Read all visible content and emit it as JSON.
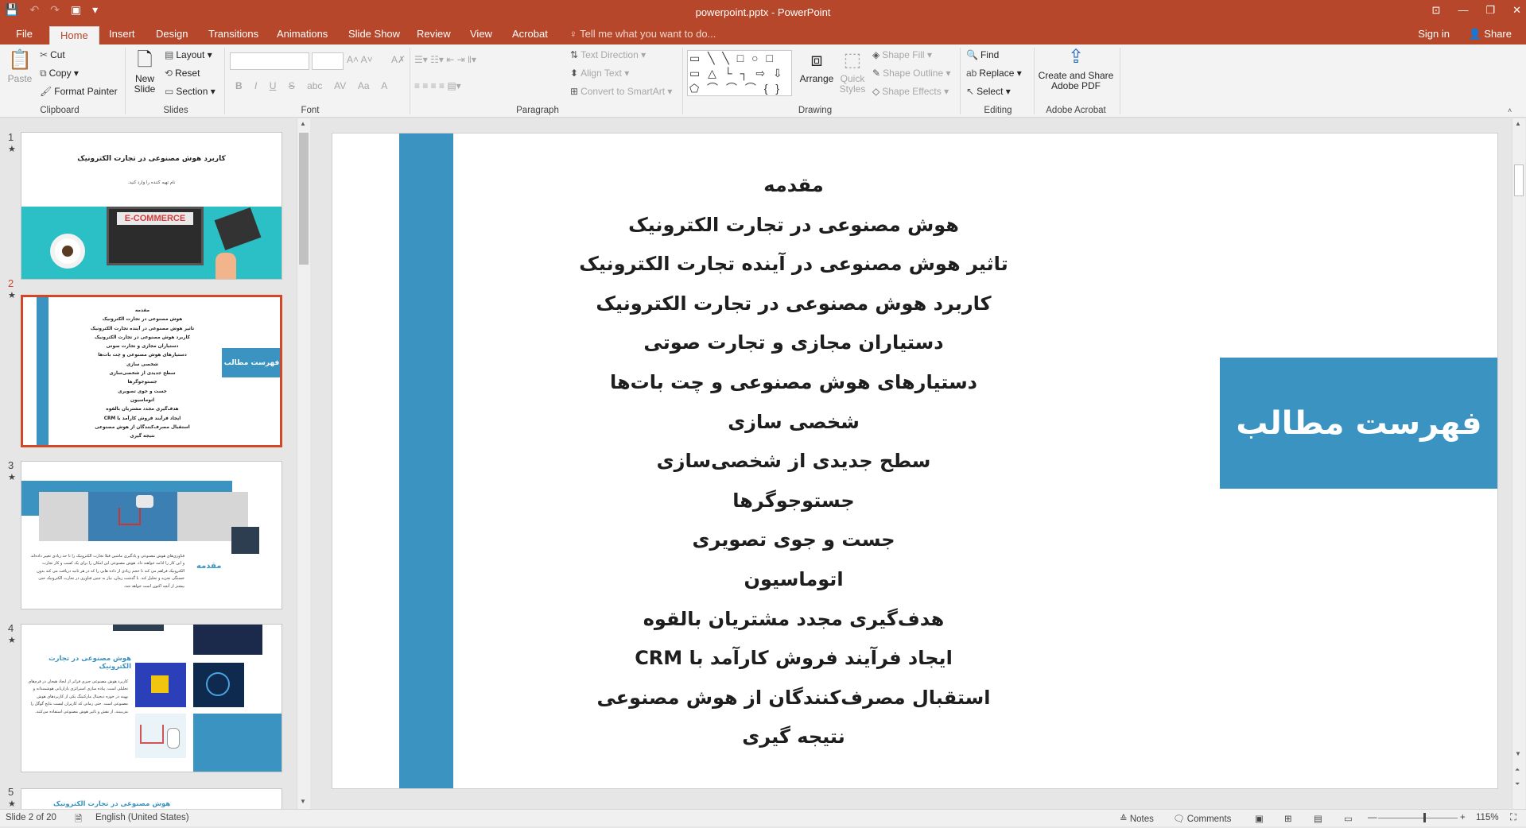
{
  "window": {
    "title": "powerpoint.pptx - PowerPoint",
    "controls": [
      "⊡",
      "—",
      "❐",
      "✕"
    ]
  },
  "qat": {
    "save": "💾",
    "undo": "↶",
    "redo": "↷",
    "present": "▣",
    "more": "▾"
  },
  "tabs": [
    "File",
    "Home",
    "Insert",
    "Design",
    "Transitions",
    "Animations",
    "Slide Show",
    "Review",
    "View",
    "Acrobat"
  ],
  "tell_me": "Tell me what you want to do...",
  "sign_in": "Sign in",
  "share": "Share",
  "ribbon": {
    "clipboard": {
      "paste": "Paste",
      "cut": "Cut",
      "copy": "Copy",
      "format_painter": "Format Painter",
      "label": "Clipboard"
    },
    "slides": {
      "new_slide": "New Slide",
      "layout": "Layout",
      "reset": "Reset",
      "section": "Section",
      "label": "Slides"
    },
    "font": {
      "bold": "B",
      "italic": "I",
      "underline": "U",
      "strike": "S",
      "shadow": "abc",
      "spacing": "AV",
      "case": "Aa",
      "color": "A",
      "label": "Font"
    },
    "paragraph": {
      "text_direction": "Text Direction",
      "align_text": "Align Text",
      "convert_smartart": "Convert to SmartArt",
      "label": "Paragraph"
    },
    "drawing": {
      "shapes": "▭ ╲ ╲ □ ○ □ ▭ △ └ ┐ ⇨ ⇩ ⬠ ⌒ ⌒ ⌒ { } ☆",
      "arrange": "Arrange",
      "quick_styles": "Quick Styles",
      "shape_fill": "Shape Fill",
      "shape_outline": "Shape Outline",
      "shape_effects": "Shape Effects",
      "label": "Drawing"
    },
    "editing": {
      "find": "Find",
      "replace": "Replace",
      "select": "Select",
      "label": "Editing"
    },
    "acrobat": {
      "create_share": "Create and Share Adobe PDF",
      "label": "Adobe Acrobat"
    }
  },
  "thumbnails": [
    {
      "num": "1",
      "title": "کاربرد هوش مصنوعی در تجارت الکترونیک",
      "subtitle": "نام تهیه کننده را وارد کنید.",
      "banner": "E-COMMERCE"
    },
    {
      "num": "2",
      "box": "فهرست مطالب"
    },
    {
      "num": "3",
      "heading": "مقدمه",
      "text": "فناوری‌های هوش مصنوعی و یادگیری ماشین قبلا تجارت الکترونیک را تا حد زیادی تغییر داده‌اند و این کار را ادامه خواهند داد. هوش مصنوعی این امکان را برای یک کسب و کار تجارت الکترونیک فراهم می کند تا حجم زیادی از داده هایی را که در هر ثانیه دریافت می کند بدون خستگی تجزیه و تحلیل کند. با گذشت زمان، نیاز به چنین فناوری در تجارت الکترونیک حتی بیشتر از آنچه اکنون است خواهد شد."
    },
    {
      "num": "4",
      "heading": "هوش مصنوعی در تجارت الکترونیک",
      "text": "کاربرد هوش مصنوعی چیزی فراتر از ایجاد هیجان در فرم‌های تحلیلی است. پیاده سازی استراتژی بازاریابی هوشمندانه و بهینه در حوزه دیجیتال مارکتینگ یکی از کاربردهای هوش مصنوعی است. حتی زمانی که کاربران لیست نتایج گوگل را می‌بینند، از نقش و تاثیر هوش مصنوعی استفاده می‌کنند."
    },
    {
      "num": "5",
      "heading": "هوش مصنوعی در تجارت الکترونیک"
    }
  ],
  "slide": {
    "toc_items": [
      "مقدمه",
      "هوش مصنوعی در تجارت الکترونیک",
      "تاثیر هوش مصنوعی در آینده تجارت الکترونیک",
      "کاربرد هوش مصنوعی در تجارت الکترونیک",
      "دستیاران مجازی و تجارت صوتی",
      "دستیارهای هوش مصنوعی و چت بات‌ها",
      "شخصی سازی",
      "سطح جدیدی از شخصی‌سازی",
      "جستوجوگرها",
      "جست و جوی تصویری",
      "اتوماسیون",
      "هدف‌گیری مجدد مشتریان بالقوه",
      "ایجاد فرآیند فروش کارآمد با CRM",
      "استقبال مصرف‌کنندگان از هوش مصنوعی",
      "نتیجه گیری"
    ],
    "box_title": "فهرست مطالب"
  },
  "status": {
    "slide_info": "Slide 2 of 20",
    "language": "English (United States)",
    "notes": "Notes",
    "comments": "Comments",
    "zoom_pct": "115%",
    "zoom_level": 0.575
  },
  "colors": {
    "accent": "#b7472a",
    "slide_blue": "#3a93c1",
    "selected_border": "#d24726"
  }
}
